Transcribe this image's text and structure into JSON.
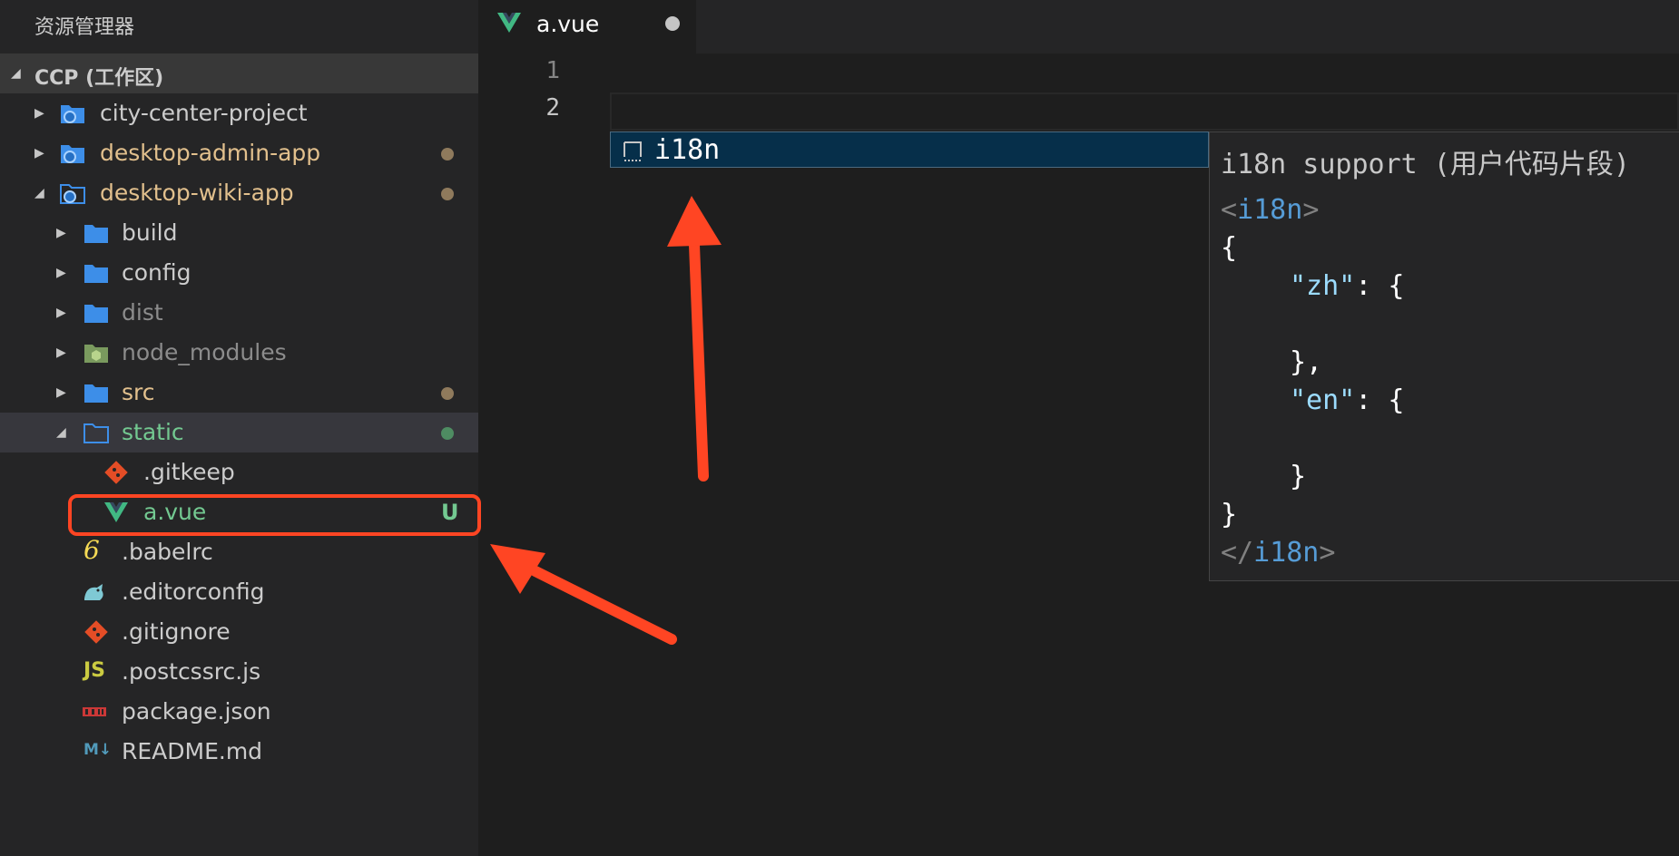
{
  "sidebar": {
    "title": "资源管理器",
    "workspace": "CCP (工作区)",
    "items": [
      {
        "label": "city-center-project",
        "color": "#cccccc",
        "dot": null,
        "icon": "repo-folder-icon",
        "twisty": "collapsed"
      },
      {
        "label": "desktop-admin-app",
        "color": "#e2c08d",
        "dot": "#8f7a5c",
        "icon": "repo-folder-icon",
        "twisty": "collapsed"
      },
      {
        "label": "desktop-wiki-app",
        "color": "#e2c08d",
        "dot": "#8f7a5c",
        "icon": "repo-folder-open-icon",
        "twisty": "expanded"
      },
      {
        "label": "build",
        "color": "#cccccc",
        "dot": null,
        "icon": "folder-icon",
        "twisty": "collapsed"
      },
      {
        "label": "config",
        "color": "#cccccc",
        "dot": null,
        "icon": "folder-icon",
        "twisty": "collapsed"
      },
      {
        "label": "dist",
        "color": "#8c8c8c",
        "dot": null,
        "icon": "folder-icon",
        "twisty": "collapsed"
      },
      {
        "label": "node_modules",
        "color": "#8c8c8c",
        "dot": null,
        "icon": "node-folder-icon",
        "twisty": "collapsed"
      },
      {
        "label": "src",
        "color": "#e2c08d",
        "dot": "#8f7a5c",
        "icon": "folder-icon",
        "twisty": "collapsed"
      },
      {
        "label": "static",
        "color": "#73c991",
        "dot": "#4e8c62",
        "icon": "folder-open-icon",
        "twisty": "expanded"
      },
      {
        "label": ".gitkeep",
        "color": "#cccccc",
        "dot": null,
        "icon": "git-icon",
        "twisty": null
      },
      {
        "label": "a.vue",
        "color": "#73c991",
        "badge": "U",
        "icon": "vue-icon",
        "twisty": null
      },
      {
        "label": ".babelrc",
        "color": "#cccccc",
        "dot": null,
        "icon": "babel-icon",
        "twisty": null
      },
      {
        "label": ".editorconfig",
        "color": "#cccccc",
        "dot": null,
        "icon": "editorconfig-icon",
        "twisty": null
      },
      {
        "label": ".gitignore",
        "color": "#cccccc",
        "dot": null,
        "icon": "git-icon",
        "twisty": null
      },
      {
        "label": ".postcssrc.js",
        "color": "#cccccc",
        "dot": null,
        "icon": "js-icon",
        "twisty": null
      },
      {
        "label": "package.json",
        "color": "#cccccc",
        "dot": null,
        "icon": "npm-icon",
        "twisty": null
      },
      {
        "label": "README.md",
        "color": "#cccccc",
        "dot": null,
        "icon": "markdown-icon",
        "twisty": null
      }
    ]
  },
  "tab": {
    "name": "a.vue",
    "modified": true
  },
  "editor": {
    "line_numbers": [
      "1",
      "2"
    ]
  },
  "suggestion": {
    "label": "i18n"
  },
  "details": {
    "title": "i18n support (用户代码片段)",
    "open_tag": "i18n",
    "zh_key": "\"zh\"",
    "en_key": "\"en\"",
    "colon_brace": ": {",
    "open_brace": "{",
    "close_brace": "}",
    "close_comma": "},"
  },
  "colors": {
    "accent_arrow": "#ff4523",
    "untracked": "#73c991",
    "modified": "#e2c08d"
  }
}
